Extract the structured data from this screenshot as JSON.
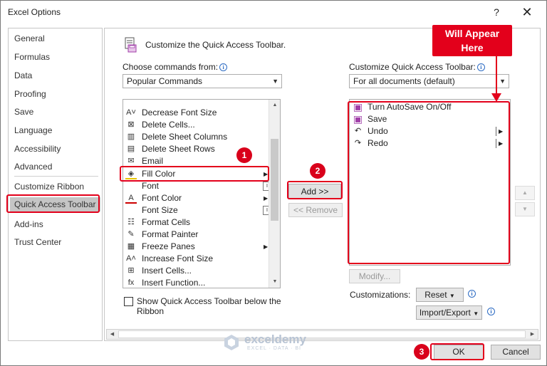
{
  "window": {
    "title": "Excel Options",
    "help_glyph": "?",
    "close_glyph": "✕"
  },
  "nav": {
    "items": [
      "General",
      "Formulas",
      "Data",
      "Proofing",
      "Save",
      "Language",
      "Accessibility",
      "Advanced",
      "Customize Ribbon",
      "Quick Access Toolbar",
      "Add-ins",
      "Trust Center"
    ],
    "selected": "Quick Access Toolbar"
  },
  "panel": {
    "header": "Customize the Quick Access Toolbar.",
    "choose_label": "Choose commands from:",
    "choose_value": "Popular Commands",
    "customize_label": "Customize Quick Access Toolbar:",
    "customize_value": "For all documents (default)"
  },
  "commands": [
    {
      "label": "Decrease Font Size",
      "icon": "decrease-font-icon",
      "glyph": "A˅"
    },
    {
      "label": "Delete Cells...",
      "icon": "delete-cells-icon",
      "glyph": "⊠"
    },
    {
      "label": "Delete Sheet Columns",
      "icon": "delete-columns-icon",
      "glyph": "▥"
    },
    {
      "label": "Delete Sheet Rows",
      "icon": "delete-rows-icon",
      "glyph": "▤"
    },
    {
      "label": "Email",
      "icon": "email-icon",
      "glyph": "✉"
    },
    {
      "label": "Fill Color",
      "icon": "fill-color-icon",
      "glyph": "◈"
    },
    {
      "label": "Font",
      "icon": "",
      "glyph": ""
    },
    {
      "label": "Font Color",
      "icon": "font-color-icon",
      "glyph": "A"
    },
    {
      "label": "Font Size",
      "icon": "",
      "glyph": ""
    },
    {
      "label": "Format Cells",
      "icon": "format-cells-icon",
      "glyph": "☷"
    },
    {
      "label": "Format Painter",
      "icon": "format-painter-icon",
      "glyph": "✎"
    },
    {
      "label": "Freeze Panes",
      "icon": "freeze-panes-icon",
      "glyph": "▦"
    },
    {
      "label": "Increase Font Size",
      "icon": "increase-font-icon",
      "glyph": "A˄"
    },
    {
      "label": "Insert Cells...",
      "icon": "insert-cells-icon",
      "glyph": "⊞"
    },
    {
      "label": "Insert Function...",
      "icon": "insert-function-icon",
      "glyph": "fx"
    }
  ],
  "qat": [
    {
      "label": "Turn AutoSave On/Off",
      "icon": "autosave-icon",
      "glyph": "▣"
    },
    {
      "label": "Save",
      "icon": "save-icon",
      "glyph": "▣"
    },
    {
      "label": "Undo",
      "icon": "undo-icon",
      "glyph": "↶"
    },
    {
      "label": "Redo",
      "icon": "redo-icon",
      "glyph": "↷"
    }
  ],
  "buttons": {
    "add": "Add >>",
    "remove": "<< Remove",
    "modify": "Modify...",
    "customizations_label": "Customizations:",
    "reset": "Reset",
    "import_export": "Import/Export",
    "ok": "OK",
    "cancel": "Cancel"
  },
  "checkbox": {
    "label_line1": "Show Quick Access Toolbar below the",
    "label_line2": "Ribbon",
    "checked": false
  },
  "annotations": {
    "callout": "Will Appear Here",
    "step1": "1",
    "step2": "2",
    "step3": "3",
    "color": "#e3001b"
  },
  "watermark": {
    "name": "exceldemy",
    "tagline": "EXCEL · DATA · BI"
  }
}
